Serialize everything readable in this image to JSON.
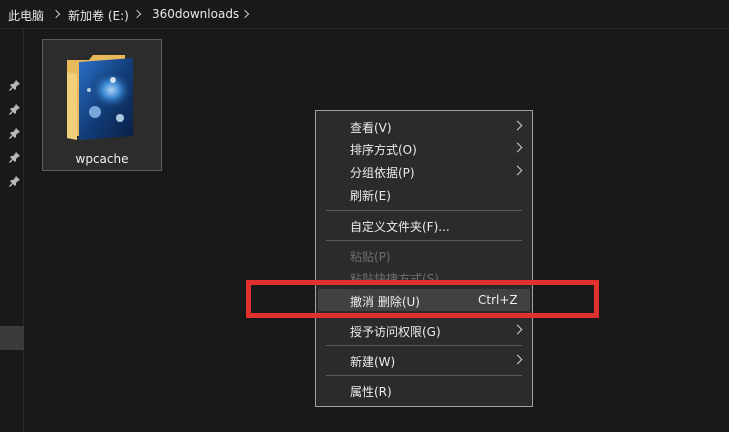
{
  "breadcrumb": {
    "items": [
      "此电脑",
      "新加卷 (E:)",
      "360downloads"
    ]
  },
  "folder": {
    "name": "wpcache"
  },
  "menu": {
    "view": "查看(V)",
    "sort": "排序方式(O)",
    "group": "分组依据(P)",
    "refresh": "刷新(E)",
    "customize": "自定义文件夹(F)...",
    "paste": "粘贴(P)",
    "paste_shortcut": "粘贴快捷方式(S)",
    "undo": "撤消 删除(U)",
    "undo_shortcut": "Ctrl+Z",
    "grant_access": "授予访问权限(G)",
    "new": "新建(W)",
    "properties": "属性(R)"
  },
  "colors": {
    "highlight_border": "#e2312d",
    "menu_bg": "#2b2b2b",
    "window_bg": "#191919"
  }
}
